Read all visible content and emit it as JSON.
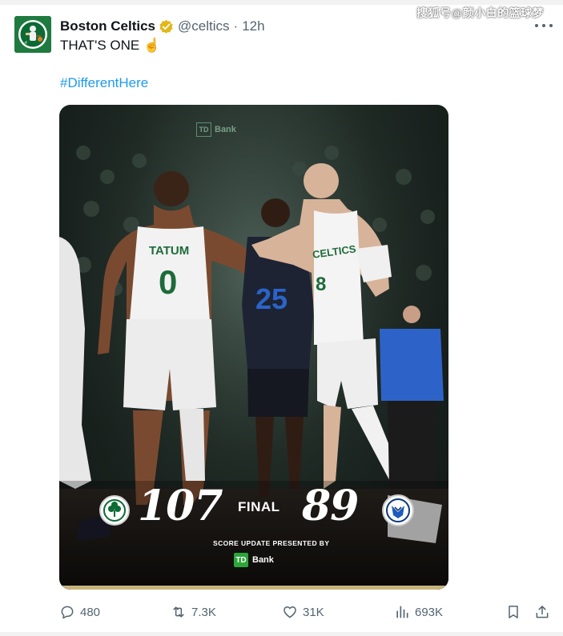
{
  "tweet": {
    "author_name": "Boston Celtics",
    "handle": "@celtics",
    "separator": "·",
    "time": "12h",
    "text": "THAT'S ONE ☝️",
    "hashtag": "#DifferentHere",
    "watermark": "搜狐号@颜小白的篮球梦"
  },
  "media": {
    "arena_sign_td": "TD",
    "arena_sign_text": "Bank",
    "player_name_jersey": "TATUM",
    "player_number_left": "0",
    "player_number_center": "25",
    "player_number_right": "8",
    "jersey_team_right": "CELTICS",
    "home_score": "107",
    "final_label": "FINAL",
    "away_score": "89",
    "presented_by": "SCORE UPDATE PRESENTED BY",
    "sponsor_td": "TD",
    "sponsor_bank": "Bank"
  },
  "actions": {
    "replies": "480",
    "reposts": "7.3K",
    "likes": "31K",
    "views": "693K"
  },
  "icons": {
    "reply": "reply-icon",
    "repost": "repost-icon",
    "like": "heart-icon",
    "views": "views-icon",
    "bookmark": "bookmark-icon",
    "share": "share-icon",
    "more": "more-icon",
    "verified": "verified-badge-icon"
  },
  "colors": {
    "accent": "#1d9bf0",
    "verified_gold": "#e2b719",
    "celtics_green": "#007a33",
    "td_green": "#2ca53a",
    "muted_text": "#536471"
  }
}
